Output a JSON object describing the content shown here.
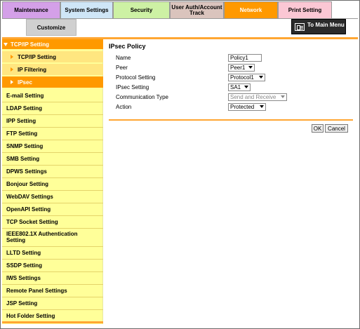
{
  "tabs": {
    "maintenance": "Maintenance",
    "system_settings": "System Settings",
    "security": "Security",
    "user_auth_line1": "User Auth/Account",
    "user_auth_line2": "Track",
    "network": "Network",
    "print_setting": "Print Setting",
    "customize": "Customize"
  },
  "main_menu_label": "To Main Menu",
  "sidebar": {
    "items": [
      {
        "label": "TCP/IP Setting"
      },
      {
        "label": "TCP/IP Setting"
      },
      {
        "label": "IP Filtering"
      },
      {
        "label": "IPsec"
      },
      {
        "label": "E-mail Setting"
      },
      {
        "label": "LDAP Setting"
      },
      {
        "label": "IPP Setting"
      },
      {
        "label": "FTP Setting"
      },
      {
        "label": "SNMP Setting"
      },
      {
        "label": "SMB Setting"
      },
      {
        "label": "DPWS Settings"
      },
      {
        "label": "Bonjour Setting"
      },
      {
        "label": "WebDAV Settings"
      },
      {
        "label": "OpenAPI Setting"
      },
      {
        "label": "TCP Socket Setting"
      },
      {
        "label": "IEEE802.1X Authentication",
        "label2": "Setting"
      },
      {
        "label": "LLTD Setting"
      },
      {
        "label": "SSDP Setting"
      },
      {
        "label": "IWS Settings"
      },
      {
        "label": "Remote Panel Settings"
      },
      {
        "label": "JSP Setting"
      },
      {
        "label": "Hot Folder Setting"
      }
    ]
  },
  "page": {
    "title": "IPsec Policy",
    "fields": {
      "name": {
        "label": "Name",
        "value": "Policy1"
      },
      "peer": {
        "label": "Peer",
        "value": "Peer1"
      },
      "protocol": {
        "label": "Protocol Setting",
        "value": "Protocol1"
      },
      "ipsec": {
        "label": "IPsec Setting",
        "value": "SA1"
      },
      "comm_type": {
        "label": "Communication Type",
        "value": "Send and Receive"
      },
      "action": {
        "label": "Action",
        "value": "Protected"
      }
    },
    "ok_label": "OK",
    "cancel_label": "Cancel"
  }
}
